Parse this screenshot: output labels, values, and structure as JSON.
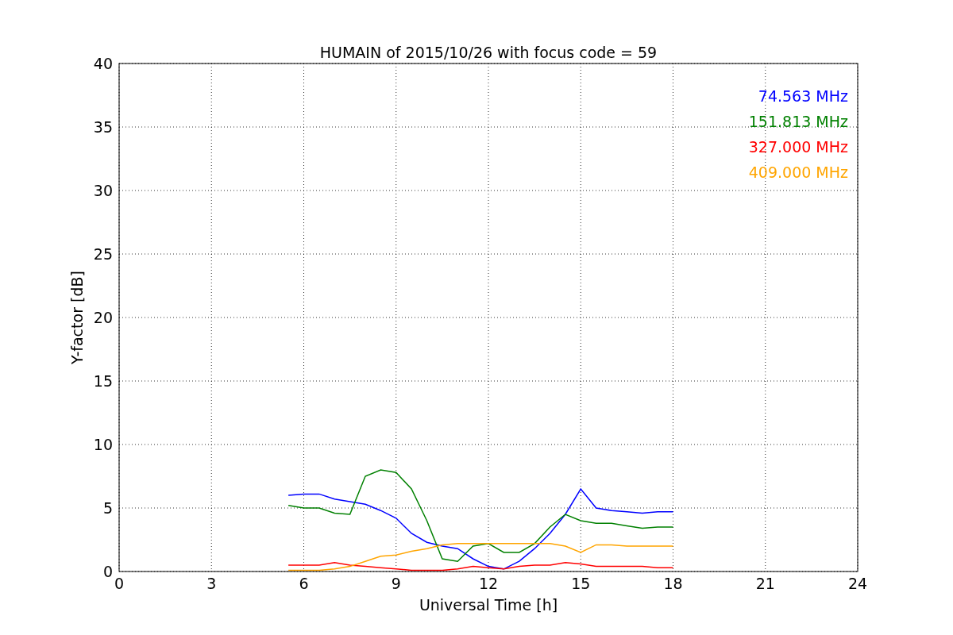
{
  "chart": {
    "chart_data": {
      "type": "line",
      "title": "HUMAIN of 2015/10/26 with focus code = 59",
      "xlabel": "Universal Time [h]",
      "ylabel": "Y-factor [dB]",
      "x": [
        5.5,
        6,
        6.5,
        7,
        7.5,
        8,
        8.5,
        9,
        9.5,
        10,
        10.5,
        11,
        11.5,
        12,
        12.5,
        13,
        13.5,
        14,
        14.5,
        15,
        15.5,
        16,
        16.5,
        17,
        17.5,
        18
      ],
      "series": [
        {
          "name": "74.563 MHz",
          "color": "#0000ff",
          "values": [
            6,
            6.1,
            6.1,
            5.7,
            5.5,
            5.3,
            4.8,
            4.2,
            3.0,
            2.3,
            2.0,
            1.8,
            1.0,
            0.4,
            0.2,
            0.8,
            1.8,
            3.0,
            4.5,
            6.5,
            5.0,
            4.8,
            4.7,
            4.6,
            4.7,
            4.7
          ]
        },
        {
          "name": "151.813 MHz",
          "color": "#008000",
          "values": [
            5.2,
            5.0,
            5.0,
            4.6,
            4.5,
            7.5,
            8.0,
            7.8,
            6.5,
            4.0,
            1.0,
            0.8,
            2.0,
            2.2,
            1.5,
            1.5,
            2.2,
            3.5,
            4.5,
            4.0,
            3.8,
            3.8,
            3.6,
            3.4,
            3.5,
            3.5
          ]
        },
        {
          "name": "327.000 MHz",
          "color": "#ff0000",
          "values": [
            0.5,
            0.5,
            0.5,
            0.7,
            0.5,
            0.4,
            0.3,
            0.2,
            0.1,
            0.1,
            0.1,
            0.2,
            0.4,
            0.3,
            0.2,
            0.4,
            0.5,
            0.5,
            0.7,
            0.6,
            0.4,
            0.4,
            0.4,
            0.4,
            0.3,
            0.3
          ]
        },
        {
          "name": "409.000 MHz",
          "color": "#ffa500",
          "values": [
            0.1,
            0.1,
            0.1,
            0.2,
            0.4,
            0.8,
            1.2,
            1.3,
            1.6,
            1.8,
            2.1,
            2.2,
            2.2,
            2.2,
            2.2,
            2.2,
            2.2,
            2.2,
            2.0,
            1.5,
            2.1,
            2.1,
            2.0,
            2.0,
            2.0,
            2.0
          ]
        }
      ],
      "xlim": [
        0,
        24
      ],
      "ylim": [
        0,
        40
      ],
      "xticks": [
        0,
        3,
        6,
        9,
        12,
        15,
        18,
        21,
        24
      ],
      "yticks": [
        0,
        5,
        10,
        15,
        20,
        25,
        30,
        35,
        40
      ],
      "grid": true
    }
  }
}
